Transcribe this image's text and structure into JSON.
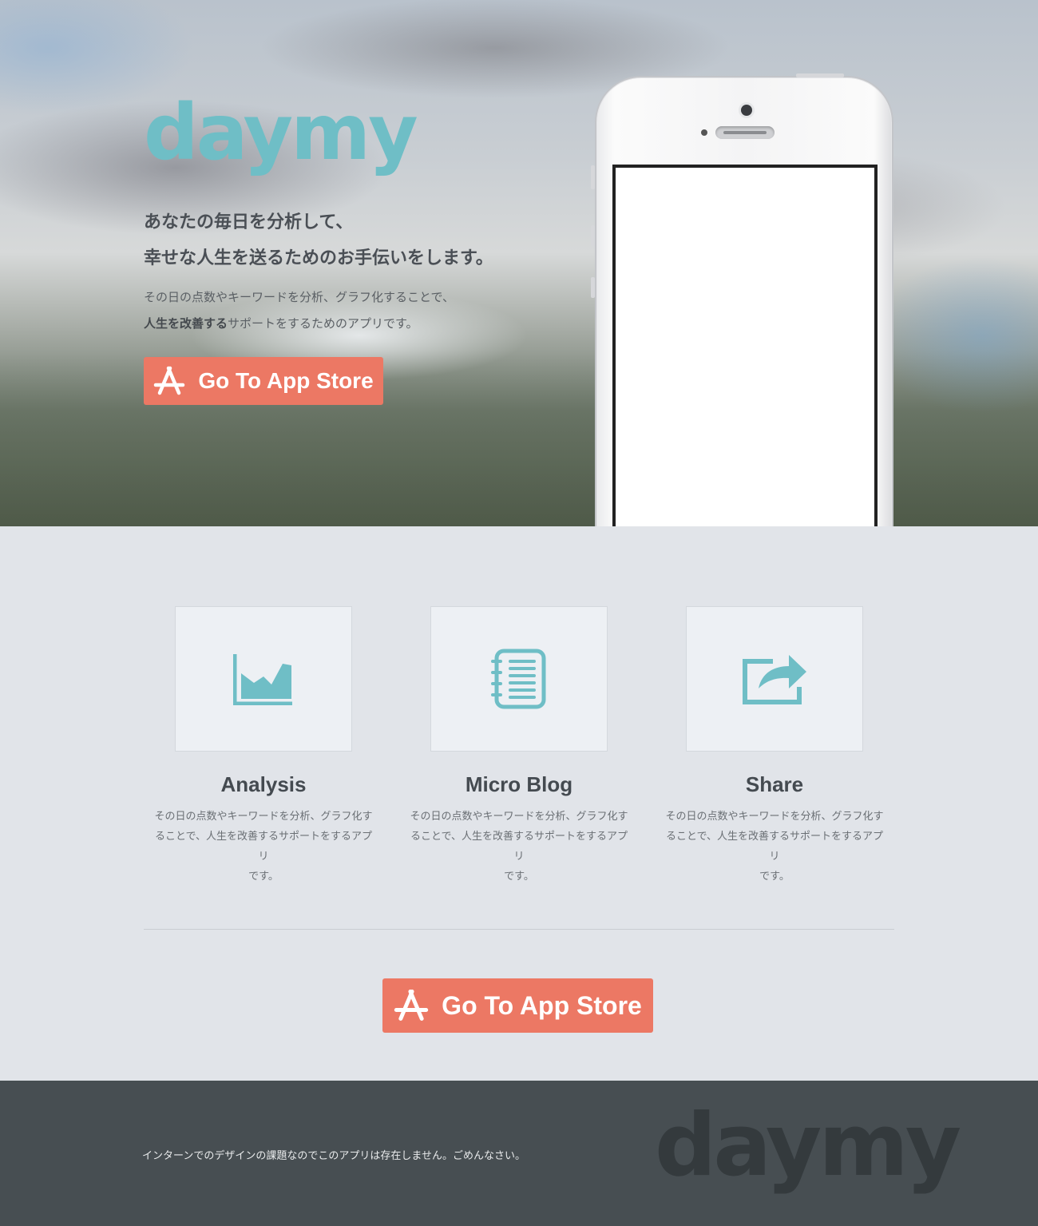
{
  "brand": {
    "logo_text": "daymy",
    "accent_color": "#6fbec6",
    "button_color": "#ec7864"
  },
  "hero": {
    "headline_line1": "あなたの毎日を分析して、",
    "headline_line2": "幸せな人生を送るためのお手伝いをします。",
    "sub_line1": "その日の点数やキーワードを分析、グラフ化することで、",
    "sub_line2_bold": "人生を改善する",
    "sub_line2_rest": "サポートをするためのアプリです。",
    "cta_label": "Go To App Store",
    "cta_icon": "app-store-icon"
  },
  "features": [
    {
      "icon": "area-chart-icon",
      "title": "Analysis",
      "desc_lines": [
        "その日の点数やキーワードを分析、グラフ化す",
        "ることで、人生を改善するサポートをするアプリ",
        "です。"
      ]
    },
    {
      "icon": "notebook-icon",
      "title": "Micro Blog",
      "desc_lines": [
        "その日の点数やキーワードを分析、グラフ化す",
        "ることで、人生を改善するサポートをするアプリ",
        "です。"
      ]
    },
    {
      "icon": "share-icon",
      "title": "Share",
      "desc_lines": [
        "その日の点数やキーワードを分析、グラフ化す",
        "ることで、人生を改善するサポートをするアプリ",
        "です。"
      ]
    }
  ],
  "bottom_cta": {
    "label": "Go To App Store",
    "icon": "app-store-icon"
  },
  "footer": {
    "note": "インターンでのデザインの課題なのでこのアプリは存在しません。ごめんなさい。",
    "logo_text": "daymy"
  }
}
